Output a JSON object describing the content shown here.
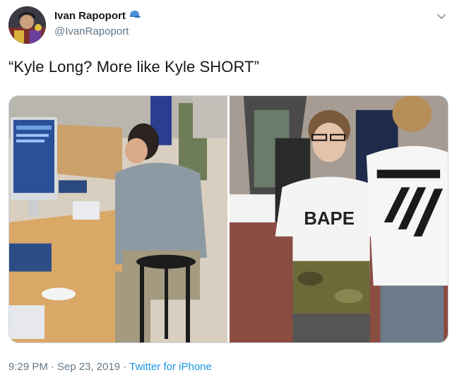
{
  "author": {
    "display_name": "Ivan Rapoport",
    "handle": "@IvanRapoport"
  },
  "tweet": {
    "text": "“Kyle Long? More like Kyle SHORT”"
  },
  "media": {
    "right_photo": {
      "shirt_text": "BAPE"
    }
  },
  "meta": {
    "time": "9:29 PM",
    "separator": "·",
    "date": "Sep 23, 2019",
    "separator2": "·",
    "source": "Twitter for iPhone"
  },
  "icons": {
    "avatar": "profile-photo",
    "badge": "cap-icon",
    "menu": "chevron-down-icon"
  },
  "colors": {
    "link": "#1b95e0",
    "secondary_text": "#657786",
    "border": "#ccd6dd"
  }
}
